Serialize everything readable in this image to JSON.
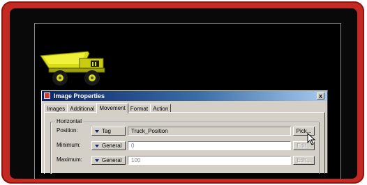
{
  "dialog": {
    "title": "Image Properties",
    "close_label": "x",
    "tabs": [
      {
        "label": "Images"
      },
      {
        "label": "Additional"
      },
      {
        "label": "Movement"
      },
      {
        "label": "Format"
      },
      {
        "label": "Action"
      }
    ],
    "active_tab": "Movement",
    "group": {
      "label": "Horizontal",
      "rows": [
        {
          "label": "Position:",
          "mode": "Tag",
          "value": "Truck_Position",
          "button": "Pick..."
        },
        {
          "label": "Minimum:",
          "mode": "General",
          "value": "0",
          "button": "Edit..."
        },
        {
          "label": "Maximum:",
          "mode": "General",
          "value": "100",
          "button": "Edit..."
        }
      ]
    }
  },
  "icons": {
    "truck": "dump-truck-icon",
    "title": "image-properties-icon",
    "dropdown": "dropdown-arrow-icon",
    "cursor": "mouse-pointer-icon"
  },
  "colors": {
    "frame": "#c42a24",
    "canvas": "#000000",
    "dialog_face": "#d4d0c8",
    "titlebar_start": "#0a246a",
    "truck_body": "#e2e61b"
  }
}
